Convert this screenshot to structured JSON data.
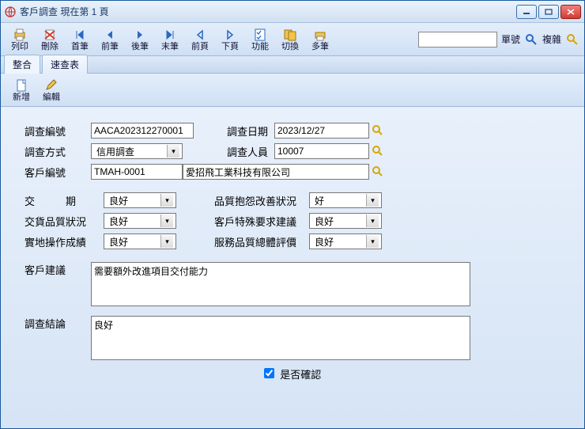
{
  "window": {
    "title": "客戶調查  現在第 1 頁"
  },
  "toolbar": {
    "print": "列印",
    "delete": "刪除",
    "first": "首筆",
    "prev": "前筆",
    "next": "後筆",
    "last": "末筆",
    "prevpage": "前頁",
    "nextpage": "下頁",
    "func": "功能",
    "switch": "切換",
    "multi": "多筆",
    "serial_label": "單號",
    "complex_label": "複雜"
  },
  "tabs": {
    "t1": "整合",
    "t2": "速查表"
  },
  "subtoolbar": {
    "add": "新增",
    "edit": "編輯"
  },
  "form": {
    "survey_no_label": "調查編號",
    "survey_no": "AACA202312270001",
    "survey_date_label": "調查日期",
    "survey_date": "2023/12/27",
    "survey_method_label": "調查方式",
    "survey_method": "信用調查",
    "surveyor_label": "調查人員",
    "surveyor": "10007",
    "cust_no_label": "客戶編號",
    "cust_no": "TMAH-0001",
    "cust_name": "愛招飛工業科技有限公司",
    "delivery_label": "交　　　期",
    "delivery": "良好",
    "quality_improve_label": "品質抱怨改善狀況",
    "quality_improve": "好",
    "delivery_quality_label": "交貨品質狀況",
    "delivery_quality": "良好",
    "cust_special_label": "客戶特殊要求建議",
    "cust_special": "良好",
    "field_op_label": "實地操作成績",
    "field_op": "良好",
    "service_eval_label": "服務品質總體評價",
    "service_eval": "良好",
    "cust_suggest_label": "客戶建議",
    "cust_suggest": "需要額外改進項目交付能力",
    "conclusion_label": "調查結論",
    "conclusion": "良好",
    "confirm_label": "是否確認",
    "confirm_checked": true
  }
}
